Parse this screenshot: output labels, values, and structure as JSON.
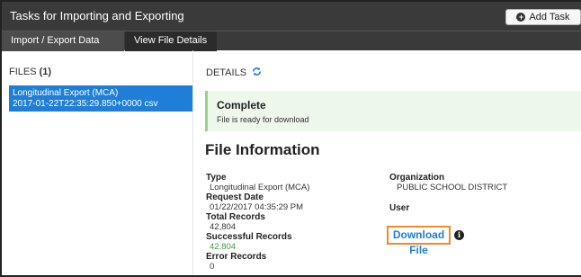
{
  "window": {
    "title": "Tasks for Importing and Exporting",
    "add_task_label": "Add Task"
  },
  "tabs": [
    {
      "label": "Import / Export Data"
    },
    {
      "label": "View File Details"
    }
  ],
  "files": {
    "header_label": "FILES",
    "count": "(1)",
    "items": [
      {
        "name": "Longitudinal Export (MCA)",
        "timestamp": "2017-01-22T22:35:29.850+0000 csv"
      }
    ]
  },
  "details": {
    "header_label": "DETAILS",
    "status": {
      "title": "Complete",
      "message": "File is ready for download"
    },
    "section_title": "File Information",
    "type_label": "Type",
    "type_value": "Longitudinal Export (MCA)",
    "request_date_label": "Request Date",
    "request_date_value": "01/22/2017 04:35:29 PM",
    "total_records_label": "Total Records",
    "total_records_value": "42,804",
    "successful_records_label": "Successful Records",
    "successful_records_value": "42,804",
    "error_records_label": "Error Records",
    "error_records_value": "0",
    "organization_label": "Organization",
    "organization_value": "PUBLIC SCHOOL DISTRICT",
    "user_label": "User",
    "download_label": "Download File"
  },
  "icons": {
    "add": "plus-circle-icon",
    "refresh": "refresh-icon",
    "info": "info-circle-icon"
  },
  "colors": {
    "titlebar": "#3a3a3a",
    "selected_file": "#1e7ed8",
    "success_bg": "#edf7ea",
    "highlight_border": "#f08a2a",
    "success_text": "#3b9a3b"
  }
}
